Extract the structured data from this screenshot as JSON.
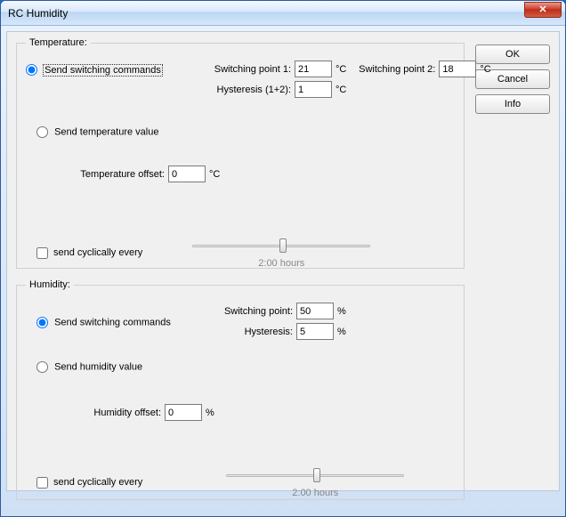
{
  "window": {
    "title": "RC Humidity",
    "close_glyph": "✕"
  },
  "buttons": {
    "ok": "OK",
    "cancel": "Cancel",
    "info": "Info"
  },
  "temperature": {
    "legend": "Temperature:",
    "radio_switch": "Send switching commands",
    "radio_value": "Send temperature value",
    "sp1_label": "Switching point 1:",
    "sp1_value": "21",
    "sp2_label": "Switching point 2:",
    "sp2_value": "18",
    "hyst_label": "Hysteresis (1+2):",
    "hyst_value": "1",
    "unit": "°C",
    "offset_label": "Temperature offset:",
    "offset_value": "0",
    "cyclic_label": "send cyclically every",
    "slider_label": "2:00 hours"
  },
  "humidity": {
    "legend": "Humidity:",
    "radio_switch": "Send switching commands",
    "radio_value": "Send humidity value",
    "sp_label": "Switching point:",
    "sp_value": "50",
    "hyst_label": "Hysteresis:",
    "hyst_value": "5",
    "unit": "%",
    "offset_label": "Humidity offset:",
    "offset_value": "0",
    "cyclic_label": "send cyclically every",
    "slider_label": "2:00 hours"
  }
}
